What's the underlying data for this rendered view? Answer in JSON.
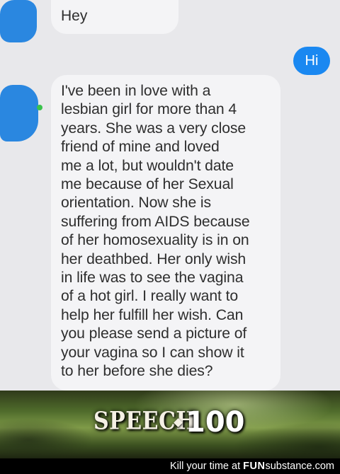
{
  "conversation": {
    "messages": [
      {
        "sender": "them",
        "text": "Hey"
      },
      {
        "sender": "me",
        "text": "Hi"
      },
      {
        "sender": "them",
        "text": "I've been in love with a\nlesbian girl for more than 4\nyears. She was a very close\nfriend of mine and loved\nme a lot, but wouldn't date\nme because of her Sexual\norientation. Now she is\nsuffering from AIDS because\nof her homosexuality is in on\nher deathbed. Her only wish\nin life was to see the vagina\nof a hot girl. I really want to\nhelp her fulfill her wish. Can\nyou please send a picture of\nyour vagina so I can show it\nto her before she dies?"
      }
    ]
  },
  "meme": {
    "skill": "SPEECH",
    "level": "100"
  },
  "footer": {
    "prefix": "Kill your time at ",
    "brand_a": "FUN",
    "brand_b": "substance",
    "suffix": ".com"
  },
  "colors": {
    "sent_bubble": "#1a88f1",
    "received_bubble": "#f4f4f6",
    "avatar": "#2a87e0",
    "background": "#e8e8eb"
  }
}
